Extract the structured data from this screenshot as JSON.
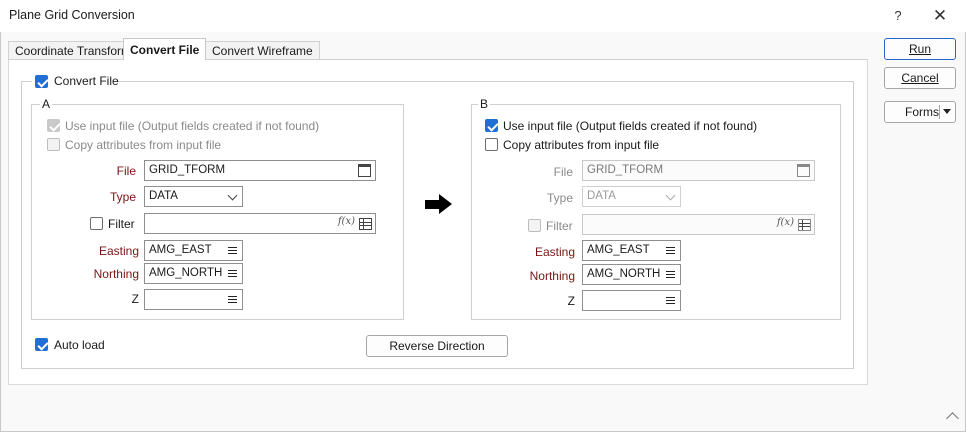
{
  "window": {
    "title": "Plane Grid Conversion",
    "help_glyph": "?",
    "close_glyph": "✕"
  },
  "tabs": [
    {
      "label": "Coordinate Transform",
      "active": false
    },
    {
      "label": "Convert File",
      "active": true
    },
    {
      "label": "Convert Wireframe",
      "active": false
    }
  ],
  "side_buttons": {
    "run": "Run",
    "cancel": "Cancel",
    "forms": "Forms"
  },
  "convert_file": {
    "label": "Convert File",
    "checked": true
  },
  "group_a": {
    "label": "A",
    "use_input_file": {
      "label": "Use input file (Output fields created if not found)",
      "checked": true,
      "disabled": true
    },
    "copy_attributes": {
      "label": "Copy attributes from input file",
      "checked": false,
      "disabled": true
    },
    "file": {
      "label": "File",
      "value": "GRID_TFORM"
    },
    "type": {
      "label": "Type",
      "value": "DATA"
    },
    "filter": {
      "label": "Filter",
      "checked": false,
      "value": "",
      "fx": "f(x)"
    },
    "easting": {
      "label": "Easting",
      "value": "AMG_EAST"
    },
    "northing": {
      "label": "Northing",
      "value": "AMG_NORTH"
    },
    "z": {
      "label": "Z",
      "value": ""
    }
  },
  "group_b": {
    "label": "B",
    "use_input_file": {
      "label": "Use input file (Output fields created if not found)",
      "checked": true
    },
    "copy_attributes": {
      "label": "Copy attributes from input file",
      "checked": false
    },
    "file": {
      "label": "File",
      "value": "GRID_TFORM"
    },
    "type": {
      "label": "Type",
      "value": "DATA"
    },
    "filter": {
      "label": "Filter",
      "checked": false,
      "value": "",
      "fx": "f(x)"
    },
    "easting": {
      "label": "Easting",
      "value": "AMG_EAST"
    },
    "northing": {
      "label": "Northing",
      "value": "AMG_NORTH"
    },
    "z": {
      "label": "Z",
      "value": ""
    }
  },
  "auto_load": {
    "label": "Auto load",
    "checked": true
  },
  "reverse_direction": {
    "label": "Reverse Direction"
  },
  "colors": {
    "accent": "#1f6fd6",
    "required_label": "#7a1414",
    "primary_border": "#2a66c8"
  }
}
